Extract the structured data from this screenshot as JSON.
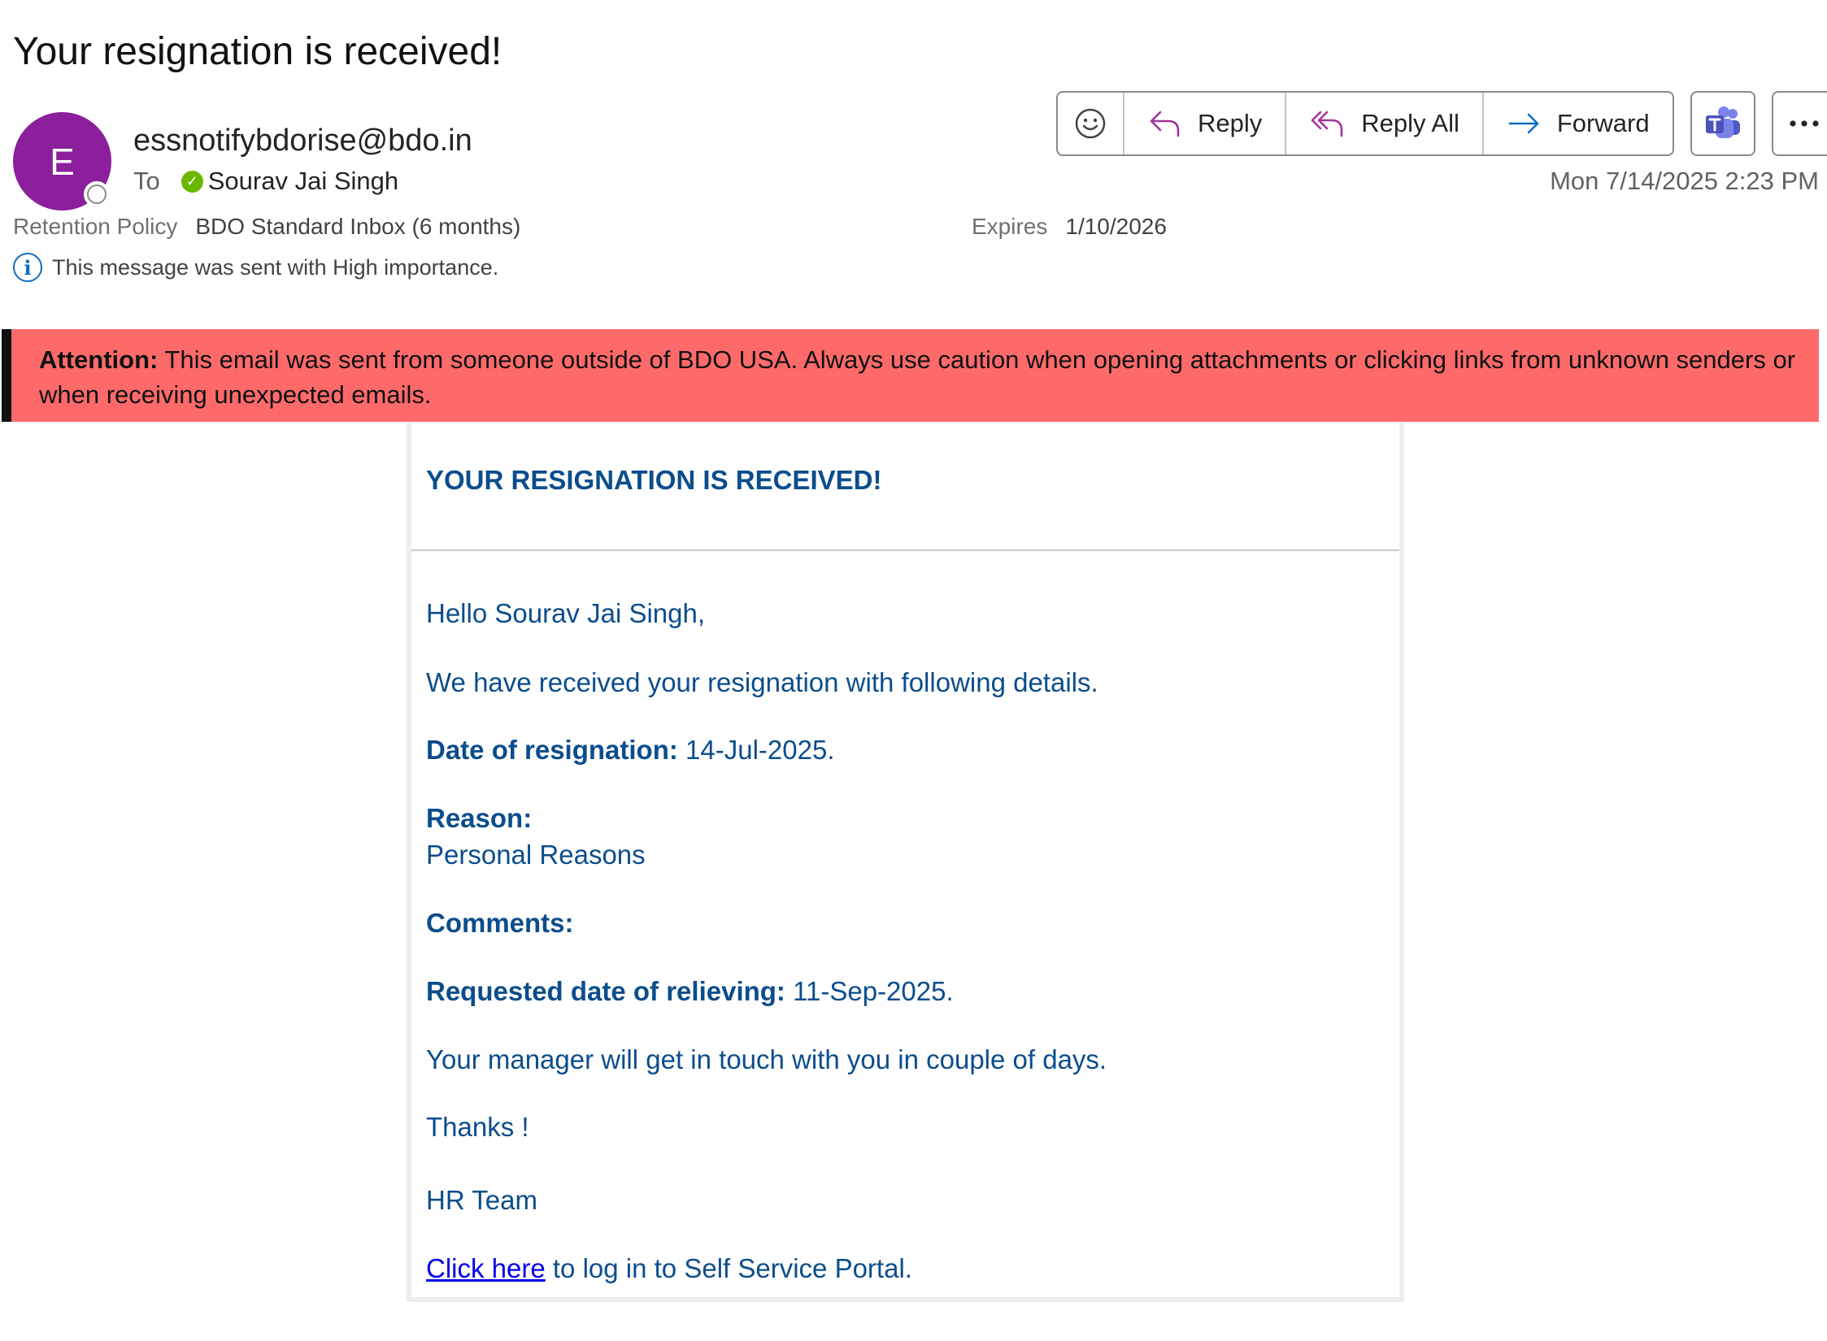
{
  "email": {
    "subject": "Your resignation is received!",
    "avatar_initial": "E",
    "sender": "essnotifybdorise@bdo.in",
    "to_label": "To",
    "recipient": "Sourav Jai Singh",
    "timestamp": "Mon 7/14/2025 2:23 PM",
    "retention_label": "Retention Policy",
    "retention_value": "BDO Standard Inbox (6 months)",
    "expires_label": "Expires",
    "expires_value": "1/10/2026",
    "importance_note": "This message was sent with High importance."
  },
  "toolbar": {
    "reply": "Reply",
    "reply_all": "Reply All",
    "forward": "Forward"
  },
  "banner": {
    "label": "Attention:",
    "text": "This email was sent from someone outside of BDO USA. Always use caution when opening attachments or clicking links from unknown senders or when receiving unexpected emails."
  },
  "body": {
    "title": "YOUR RESIGNATION IS RECEIVED!",
    "greeting": "Hello Sourav Jai Singh,",
    "intro": "We have received your resignation with following details.",
    "date_label": "Date of resignation:",
    "date_value": "14-Jul-2025.",
    "reason_label": "Reason:",
    "reason_value": "Personal Reasons",
    "comments_label": "Comments:",
    "relieving_label": "Requested date of relieving:",
    "relieving_value": "11-Sep-2025.",
    "manager_note": "Your manager will get in touch with you in couple of days.",
    "thanks": "Thanks !",
    "signature": "HR Team",
    "link_text": "Click here",
    "link_suffix": " to log in to Self Service Portal."
  }
}
